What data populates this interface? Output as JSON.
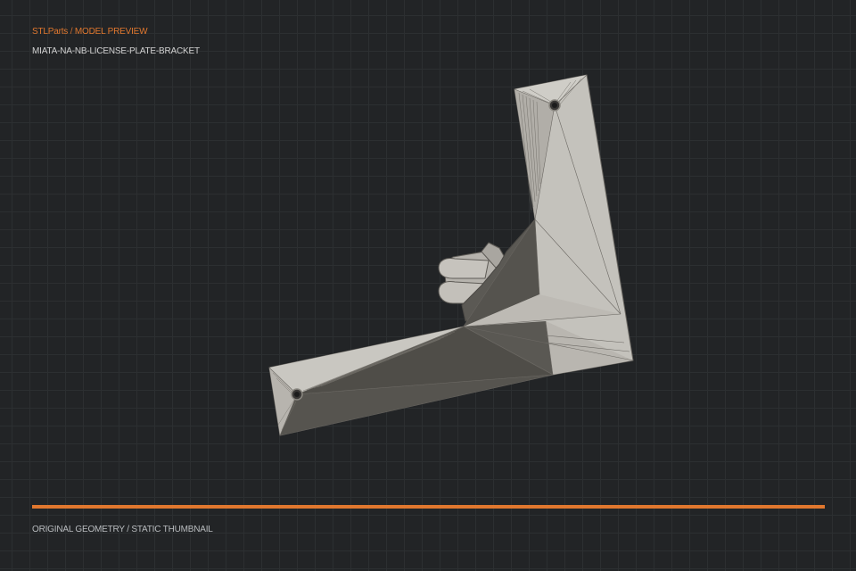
{
  "header": {
    "brand": "STLParts",
    "separator": "/",
    "section": "MODEL PREVIEW",
    "model_name": "MIATA-NA-NB-LICENSE-PLATE-BRACKET"
  },
  "footer": {
    "caption": "ORIGINAL GEOMETRY / STATIC THUMBNAIL"
  },
  "colors": {
    "accent": "#e0772e",
    "background": "#222426",
    "model_light": "#c4c2bc",
    "model_dark": "#4d4b46"
  },
  "model": {
    "render": "mesh-thumbnail",
    "mounting_holes": 2
  }
}
